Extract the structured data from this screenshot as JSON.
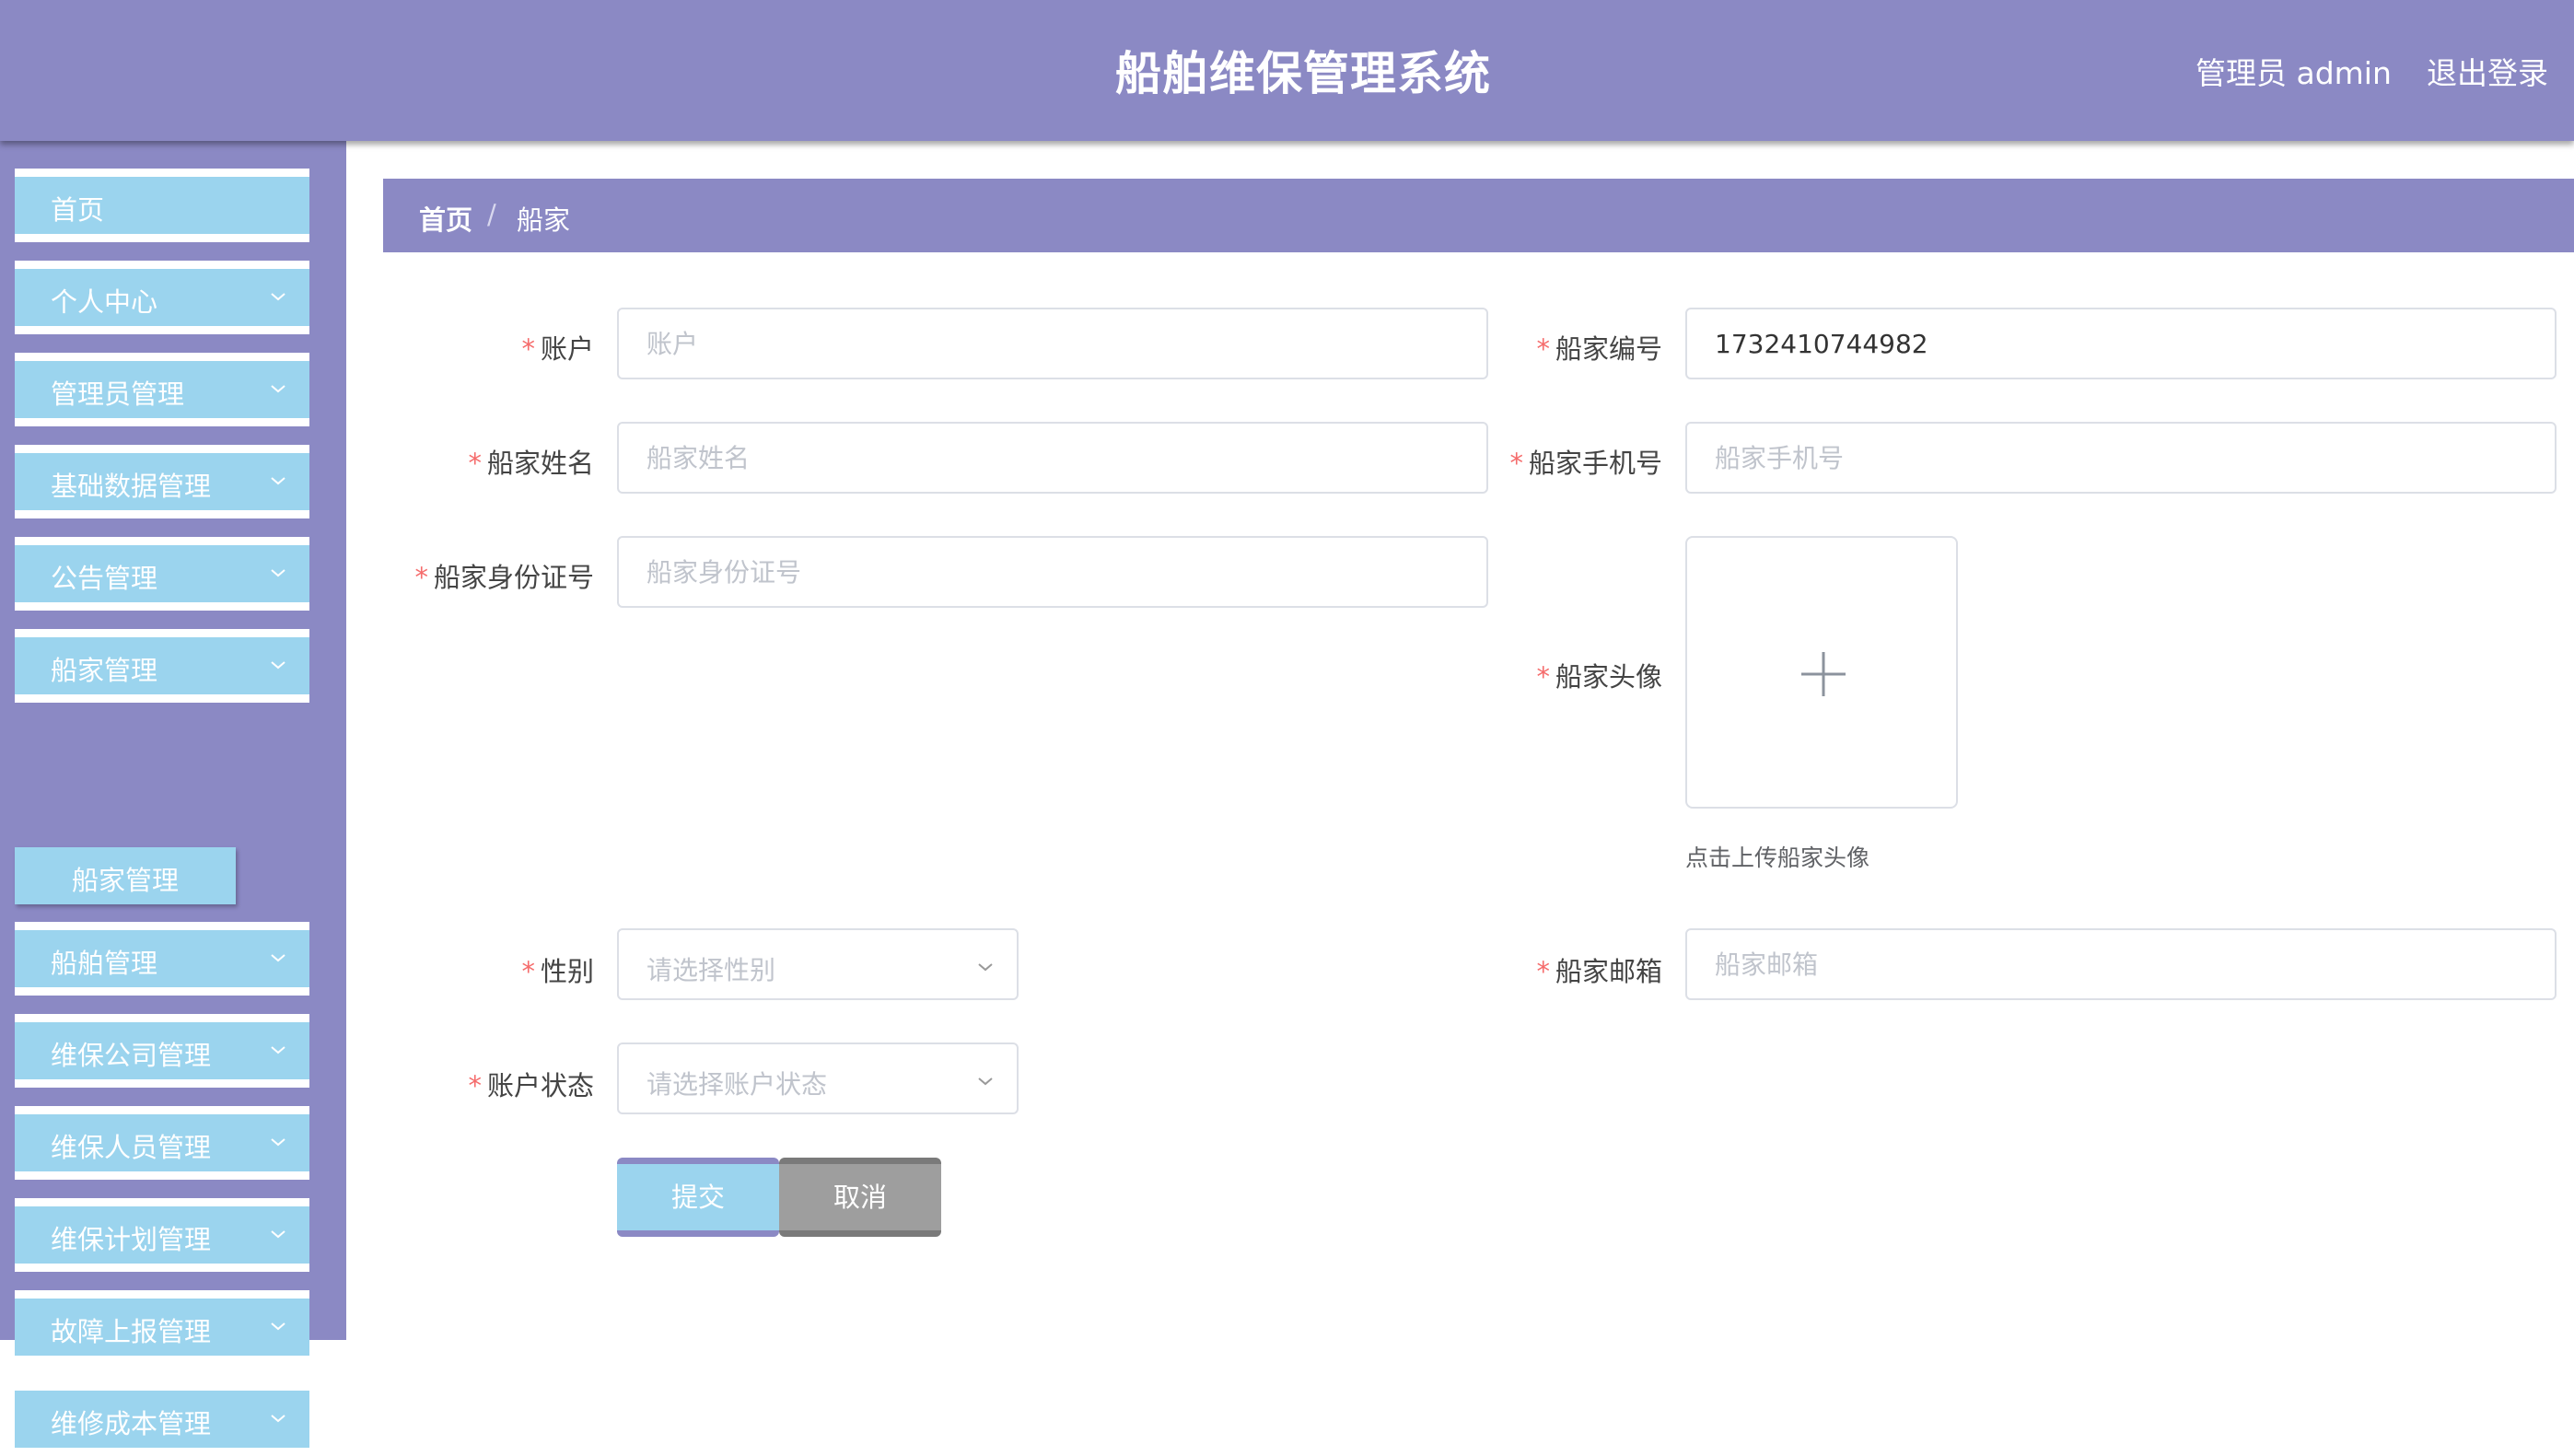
{
  "header": {
    "title": "船舶维保管理系统",
    "user": "管理员 admin",
    "logout": "退出登录"
  },
  "sidebar": {
    "items": [
      {
        "label": "首页",
        "has_children": false
      },
      {
        "label": "个人中心",
        "has_children": true
      },
      {
        "label": "管理员管理",
        "has_children": true
      },
      {
        "label": "基础数据管理",
        "has_children": true
      },
      {
        "label": "公告管理",
        "has_children": true
      },
      {
        "label": "船家管理",
        "has_children": true,
        "expanded": true
      },
      {
        "label": "船舶管理",
        "has_children": true
      },
      {
        "label": "维保公司管理",
        "has_children": true
      },
      {
        "label": "维保人员管理",
        "has_children": true
      },
      {
        "label": "维保计划管理",
        "has_children": true
      },
      {
        "label": "故障上报管理",
        "has_children": true
      },
      {
        "label": "维修成本管理",
        "has_children": true
      }
    ],
    "submenu": {
      "label": "船家管理"
    }
  },
  "breadcrumb": {
    "home": "首页",
    "separator": "/",
    "current": "船家"
  },
  "form": {
    "account": {
      "label": "账户",
      "value": "",
      "placeholder": "账户"
    },
    "owner_no": {
      "label": "船家编号",
      "value": "1732410744982",
      "placeholder": ""
    },
    "owner_name": {
      "label": "船家姓名",
      "value": "",
      "placeholder": "船家姓名"
    },
    "owner_phone": {
      "label": "船家手机号",
      "value": "",
      "placeholder": "船家手机号"
    },
    "owner_id_card": {
      "label": "船家身份证号",
      "value": "",
      "placeholder": "船家身份证号"
    },
    "avatar": {
      "label": "船家头像",
      "hint": "点击上传船家头像"
    },
    "gender": {
      "label": "性别",
      "placeholder": "请选择性别"
    },
    "email": {
      "label": "船家邮箱",
      "value": "",
      "placeholder": "船家邮箱"
    },
    "account_status": {
      "label": "账户状态",
      "placeholder": "请选择账户状态"
    },
    "required_mark": "*",
    "submit": "提交",
    "cancel": "取消"
  },
  "colors": {
    "primary": "#8b89c4",
    "menu_item": "#9bd4ee",
    "required": "#f56c6c",
    "cancel": "#9e9e9e"
  }
}
